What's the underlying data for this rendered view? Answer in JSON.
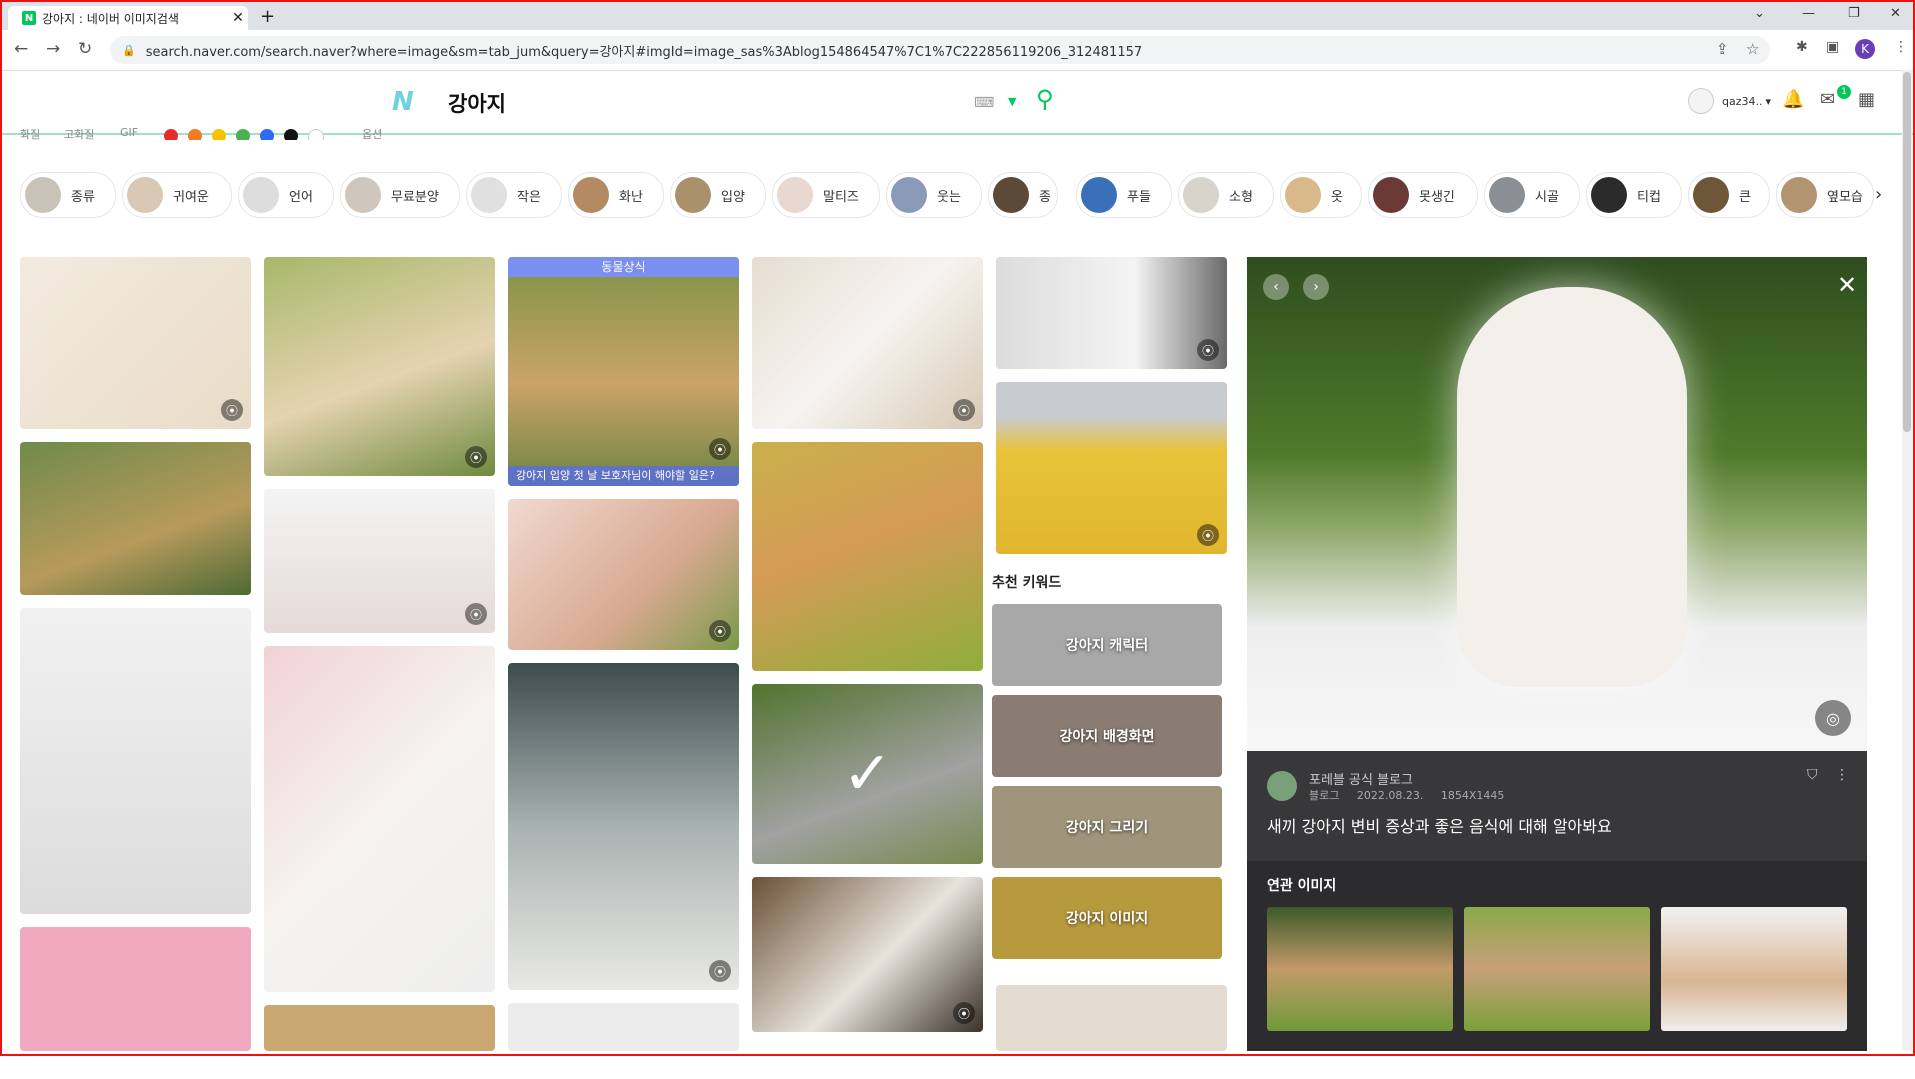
{
  "browser": {
    "tab_title": "강아지 : 네이버 이미지검색",
    "favicon": "N",
    "url": "search.naver.com/search.naver?where=image&sm=tab_jum&query=강아지#imgId=image_sas%3Ablog154864547%7C1%7C222856119206_312481157",
    "profile_initial": "K"
  },
  "header": {
    "query": "강아지",
    "user_id": "qaz34..",
    "mail_badge": "1",
    "accent": "#03c75a"
  },
  "filters": {
    "items": [
      "화질",
      "고화질",
      "GIF"
    ],
    "colors": [
      "#e52d27",
      "#f47b20",
      "#f5c400",
      "#4caf50",
      "#2d6bf2",
      "#111111",
      "#ffffff"
    ],
    "extra": "옵션"
  },
  "chips": [
    "종류",
    "귀여운",
    "언어",
    "무료분양",
    "작은",
    "화난",
    "입양",
    "말티즈",
    "웃는",
    "종",
    "푸들",
    "소형",
    "옷",
    "못생긴",
    "시골",
    "티컵",
    "큰",
    "옆모습"
  ],
  "grid": {
    "caption_top": "동물상식",
    "caption_bottom": "강아지 입양 첫 날 보호자님이 해야할 일은?",
    "recommend_title": "추천 키워드",
    "recommend": [
      "강아지 캐릭터",
      "강아지 배경화면",
      "강아지 그리기",
      "강아지 이미지"
    ]
  },
  "viewer": {
    "source": "포레블 공식 블로그",
    "type": "블로그",
    "date": "2022.08.23.",
    "size": "1854X1445",
    "title": "새끼 강아지 변비 증상과 좋은 음식에 대해 알아봐요",
    "related_title": "연관 이미지"
  }
}
